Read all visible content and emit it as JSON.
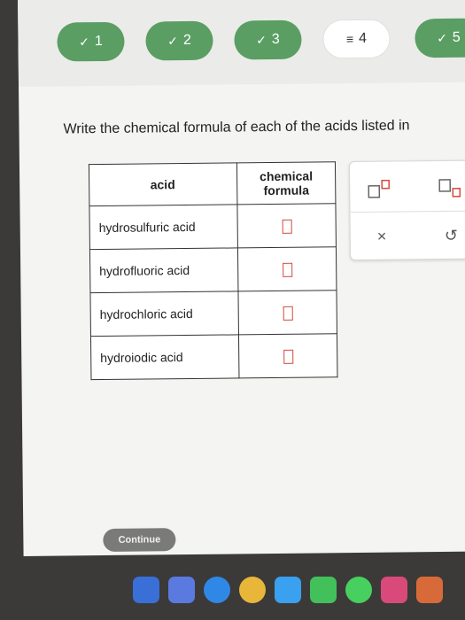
{
  "steps": [
    {
      "mark": "✓",
      "label": "1"
    },
    {
      "mark": "✓",
      "label": "2"
    },
    {
      "mark": "✓",
      "label": "3"
    },
    {
      "mark": "≡",
      "label": "4"
    },
    {
      "mark": "✓",
      "label": "5"
    }
  ],
  "question": {
    "prompt": "Write the chemical formula of each of the acids listed in"
  },
  "table": {
    "headers": {
      "acid": "acid",
      "formula": "chemical formula"
    },
    "rows": [
      {
        "acid": "hydrosulfuric acid"
      },
      {
        "acid": "hydrofluoric acid"
      },
      {
        "acid": "hydrochloric acid"
      },
      {
        "acid": "hydroiodic acid"
      }
    ]
  },
  "tools": {
    "superscript_icon": "superscript-icon",
    "subscript_icon": "subscript-icon",
    "clear_glyph": "×",
    "undo_glyph": "↺"
  },
  "footer": {
    "continue_label": "Continue"
  },
  "colors": {
    "step_done": "#5a9e63",
    "answer_box": "#d24b3a"
  }
}
